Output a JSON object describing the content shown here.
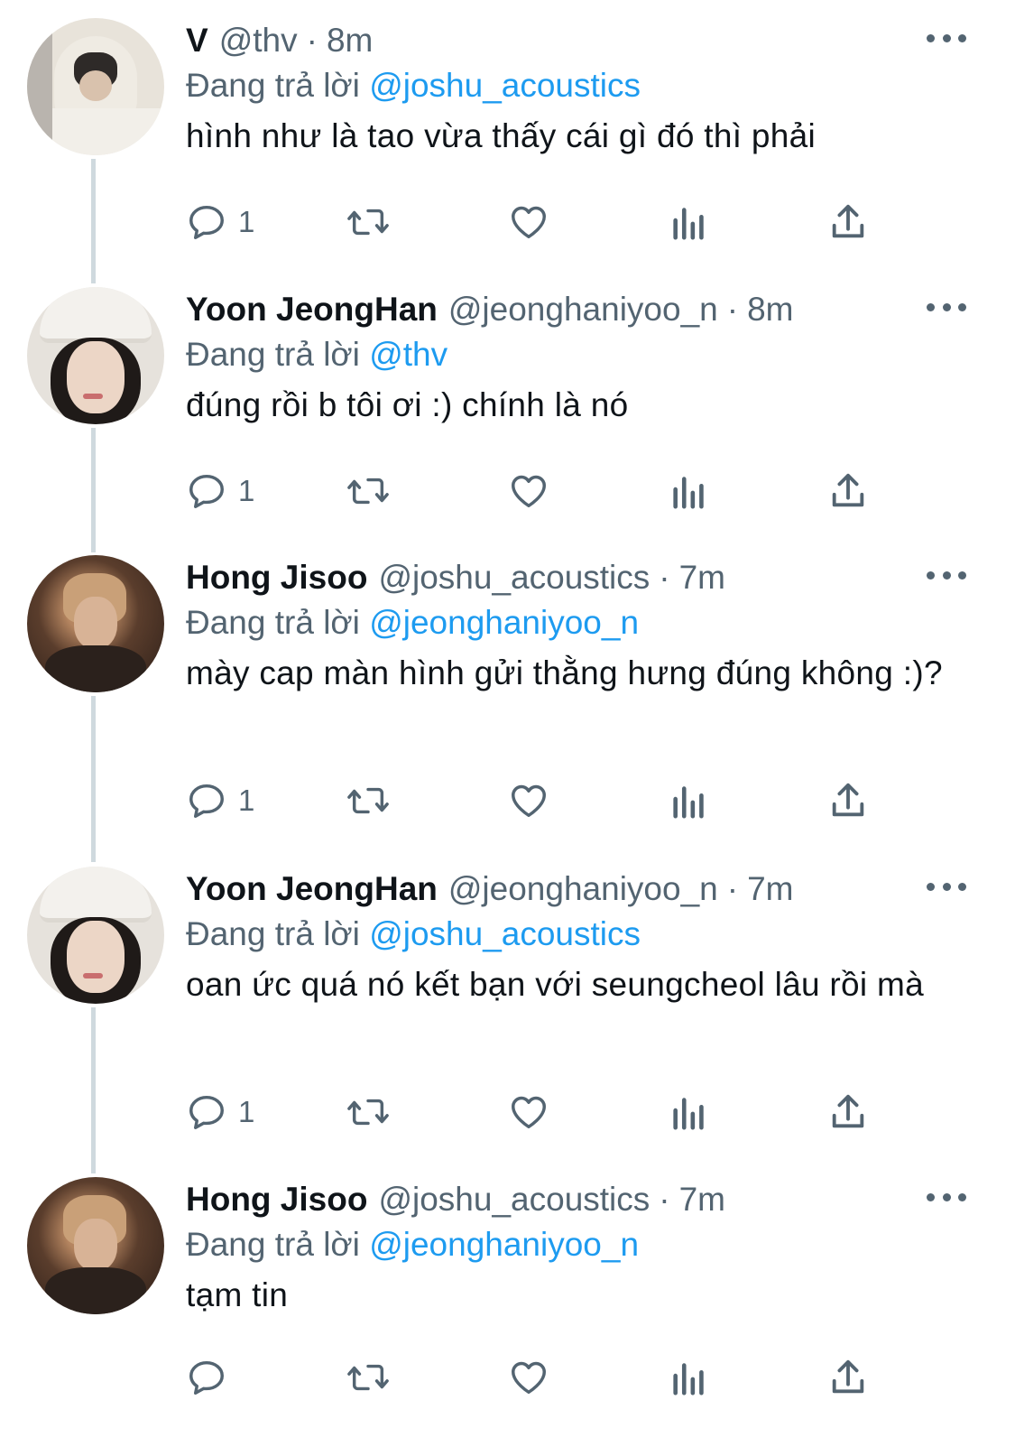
{
  "reply_prefix": "Đang trả lời",
  "tweets": [
    {
      "display_name": "V",
      "handle": "@thv",
      "dot": "·",
      "time": "8m",
      "reply_to": "@joshu_acoustics",
      "text": "hình như là tao vừa thấy cái gì đó thì phải",
      "reply_count": "1"
    },
    {
      "display_name": "Yoon JeongHan",
      "handle": "@jeonghaniyoo_n",
      "dot": "·",
      "time": "8m",
      "reply_to": "@thv",
      "text": "đúng rồi b tôi ơi :) chính là nó",
      "reply_count": "1"
    },
    {
      "display_name": "Hong Jisoo",
      "handle": "@joshu_acoustics",
      "dot": "·",
      "time": "7m",
      "reply_to": "@jeonghaniyoo_n",
      "text": "mày cap màn hình gửi thằng hưng đúng không :)?",
      "reply_count": "1"
    },
    {
      "display_name": "Yoon JeongHan",
      "handle": "@jeonghaniyoo_n",
      "dot": "·",
      "time": "7m",
      "reply_to": "@joshu_acoustics",
      "text": "oan ức quá nó kết bạn với seungcheol lâu rồi mà",
      "reply_count": "1"
    },
    {
      "display_name": "Hong Jisoo",
      "handle": "@joshu_acoustics",
      "dot": "·",
      "time": "7m",
      "reply_to": "@jeonghaniyoo_n",
      "text": "tạm tin",
      "reply_count": ""
    }
  ],
  "icons": {
    "reply": "speech-bubble-icon",
    "retweet": "retweet-arrows-icon",
    "like": "heart-icon",
    "views": "bar-chart-icon",
    "share": "share-upload-icon",
    "more": "three-dots-icon"
  },
  "colors": {
    "link": "#1d9bf0",
    "secondary_text": "#536471",
    "primary_text": "#0f1419",
    "thread_line": "#cfd9de"
  }
}
